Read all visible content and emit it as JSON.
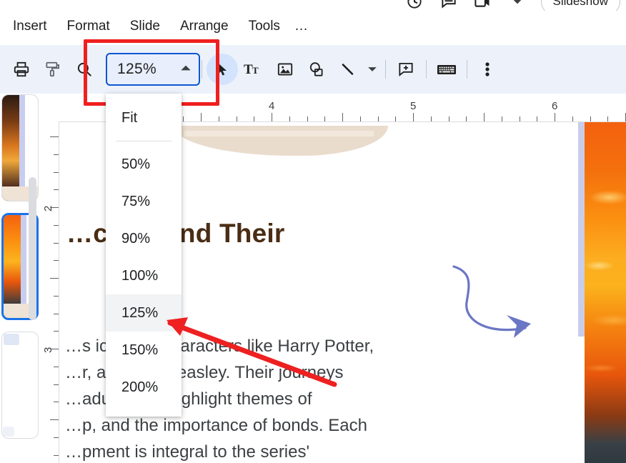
{
  "app": {
    "name": "Google Slides",
    "accent_blue": "#0b57d0",
    "toolbar_bg": "#edf2fa",
    "annotation_red": "#f01f1f",
    "selection_blue": "#1a73e8"
  },
  "topbar": {
    "icons": [
      {
        "name": "version-history-icon",
        "label": "Version history"
      },
      {
        "name": "comment-history-icon",
        "label": "Open comment history"
      },
      {
        "name": "meet-camera-icon",
        "label": "Join a call"
      },
      {
        "name": "chevron-down-icon",
        "label": "More options"
      }
    ],
    "slideshow_button": "Slideshow"
  },
  "menubar": {
    "items": [
      {
        "label": "Insert",
        "name": "menu-insert"
      },
      {
        "label": "Format",
        "name": "menu-format"
      },
      {
        "label": "Slide",
        "name": "menu-slide"
      },
      {
        "label": "Arrange",
        "name": "menu-arrange"
      },
      {
        "label": "Tools",
        "name": "menu-tools"
      }
    ],
    "overflow": "…"
  },
  "toolbar": {
    "print_label": "Print",
    "paint_format_label": "Paint format",
    "zoom_icon_label": "Zoom",
    "select_label": "Select",
    "textbox_label": "Text box",
    "image_label": "Insert image",
    "shape_label": "Shape",
    "line_label": "Line",
    "line_caret_label": "Line options",
    "comment_label": "Add comment",
    "keyboard_label": "On-screen keyboard",
    "more_label": "More"
  },
  "zoom_control": {
    "name": "zoom-combobox",
    "value": "125%",
    "caret": "▲",
    "expanded": true
  },
  "zoom_menu": {
    "items": [
      {
        "label": "Fit",
        "selected": false
      },
      {
        "label": "50%",
        "selected": false
      },
      {
        "label": "75%",
        "selected": false
      },
      {
        "label": "90%",
        "selected": false
      },
      {
        "label": "100%",
        "selected": false
      },
      {
        "label": "125%",
        "selected": true
      },
      {
        "label": "150%",
        "selected": false
      },
      {
        "label": "200%",
        "selected": false
      }
    ]
  },
  "filmstrip": {
    "slides": [
      {
        "index": "1",
        "active": false
      },
      {
        "index": "2",
        "active": true
      },
      {
        "index": "3",
        "active": false
      }
    ]
  },
  "ruler": {
    "horizontal_labels": [
      "4",
      "5",
      "6"
    ],
    "vertical_labels": [
      "2",
      "3"
    ]
  },
  "slide": {
    "title": "…cters and Their",
    "body": "…s icon… …aracters like Harry Potter,\n…r, an… …Weasley. Their journeys\n…adul… …ighlight themes of\n…p, and the importance of bonds. Each\n…pment is integral to the series'",
    "decor_arrow_name": "curved-arrow-decoration"
  },
  "annotations": {
    "highlight_box_label": "zoom-control-highlight",
    "pointer_arrow_label": "pointer-to-125-percent"
  }
}
